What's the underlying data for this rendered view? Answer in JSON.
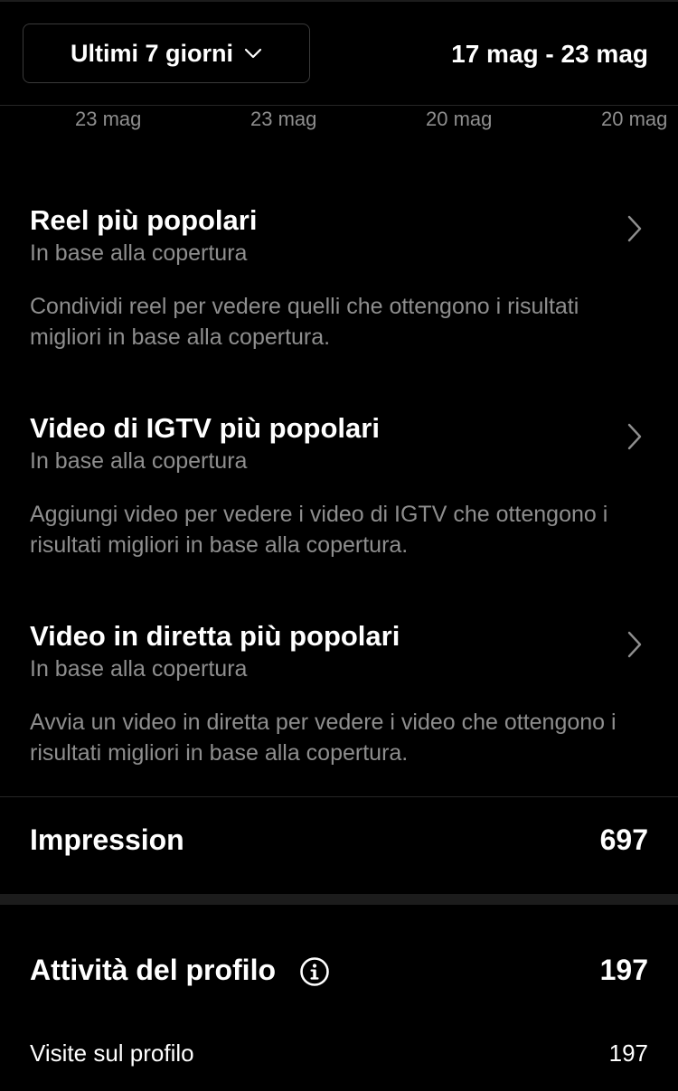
{
  "header": {
    "range_label": "Ultimi 7 giorni",
    "date_range": "17 mag - 23 mag"
  },
  "date_strip": [
    "23 mag",
    "23 mag",
    "20 mag",
    "20 mag"
  ],
  "sections": [
    {
      "title": "Reel più popolari",
      "subtitle": "In base alla copertura",
      "description": "Condividi reel per vedere quelli che ottengono i risultati migliori in base alla copertura."
    },
    {
      "title": "Video di IGTV più popolari",
      "subtitle": "In base alla copertura",
      "description": "Aggiungi video per vedere i video di IGTV che ottengono i risultati migliori in base alla copertura."
    },
    {
      "title": "Video in diretta più popolari",
      "subtitle": "In base alla copertura",
      "description": "Avvia un video in diretta per vedere i video che ottengono i risultati migliori in base alla copertura."
    }
  ],
  "impressions": {
    "label": "Impression",
    "value": "697"
  },
  "profile_activity": {
    "label": "Attività del profilo",
    "value": "197",
    "icon": "info-icon",
    "items": [
      {
        "label": "Visite sul profilo",
        "value": "197"
      }
    ]
  },
  "colors": {
    "background": "#000000",
    "text_primary": "#ffffff",
    "text_secondary": "#8e8e8e",
    "divider": "#262626"
  }
}
